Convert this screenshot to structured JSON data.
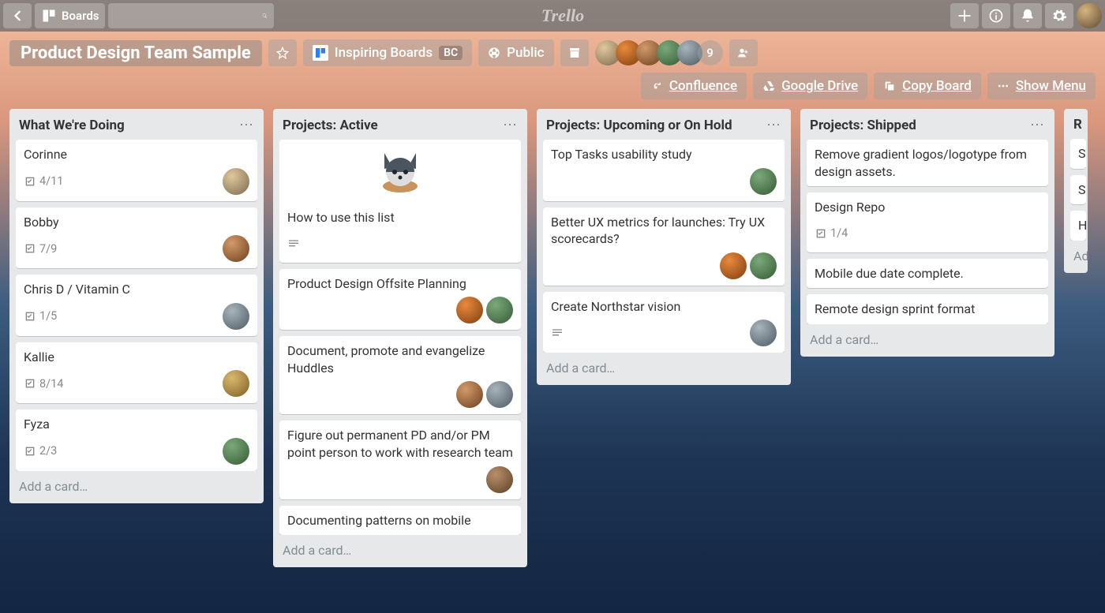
{
  "app": {
    "name": "Trello"
  },
  "topbar": {
    "boards_label": "Boards",
    "search_placeholder": ""
  },
  "board_header": {
    "title": "Product Design Team Sample",
    "workspace_label": "Inspiring Boards",
    "workspace_tag": "BC",
    "visibility": "Public",
    "members_overflow": "9",
    "actions": {
      "confluence": "Confluence",
      "gdrive": "Google Drive",
      "copy_board": "Copy Board",
      "show_menu": "Show Menu"
    }
  },
  "lists": [
    {
      "title": "What We're Doing",
      "add_label": "Add a card…",
      "cards": [
        {
          "title": "Corinne",
          "checklist": "4/11",
          "members": [
            "c1"
          ]
        },
        {
          "title": "Bobby",
          "checklist": "7/9",
          "members": [
            "c2"
          ]
        },
        {
          "title": "Chris D / Vitamin C",
          "checklist": "1/5",
          "members": [
            "c3"
          ]
        },
        {
          "title": "Kallie",
          "checklist": "8/14",
          "members": [
            "c4"
          ]
        },
        {
          "title": "Fyza",
          "checklist": "2/3",
          "members": [
            "c5"
          ]
        }
      ]
    },
    {
      "title": "Projects: Active",
      "add_label": "Add a card…",
      "cards": [
        {
          "title": "How to use this list",
          "has_desc": true,
          "cover": true
        },
        {
          "title": "Product Design Offsite Planning",
          "members": [
            "c6",
            "c5"
          ]
        },
        {
          "title": "Document, promote and evangelize Huddles",
          "members": [
            "c2",
            "c3"
          ]
        },
        {
          "title": "Figure out permanent PD and/or PM point person to work with research team",
          "members": [
            "c7"
          ]
        },
        {
          "title": "Documenting patterns on mobile"
        }
      ]
    },
    {
      "title": "Projects: Upcoming or On Hold",
      "add_label": "Add a card…",
      "cards": [
        {
          "title": "Top Tasks usability study",
          "members": [
            "c5"
          ]
        },
        {
          "title": "Better UX metrics for launches: Try UX scorecards?",
          "members": [
            "c6",
            "c5"
          ]
        },
        {
          "title": "Create Northstar vision",
          "has_desc": true,
          "members": [
            "c3"
          ]
        }
      ]
    },
    {
      "title": "Projects: Shipped",
      "add_label": "Add a card…",
      "cards": [
        {
          "title": "Remove gradient logos/logotype from design assets."
        },
        {
          "title": "Design Repo",
          "checklist": "1/4"
        },
        {
          "title": "Mobile due date complete."
        },
        {
          "title": "Remote design sprint format"
        }
      ]
    },
    {
      "title": "R",
      "add_label": "Ad",
      "partial": true,
      "cards": [
        {
          "title": "S"
        },
        {
          "title": "S"
        },
        {
          "title": "H"
        }
      ]
    }
  ]
}
